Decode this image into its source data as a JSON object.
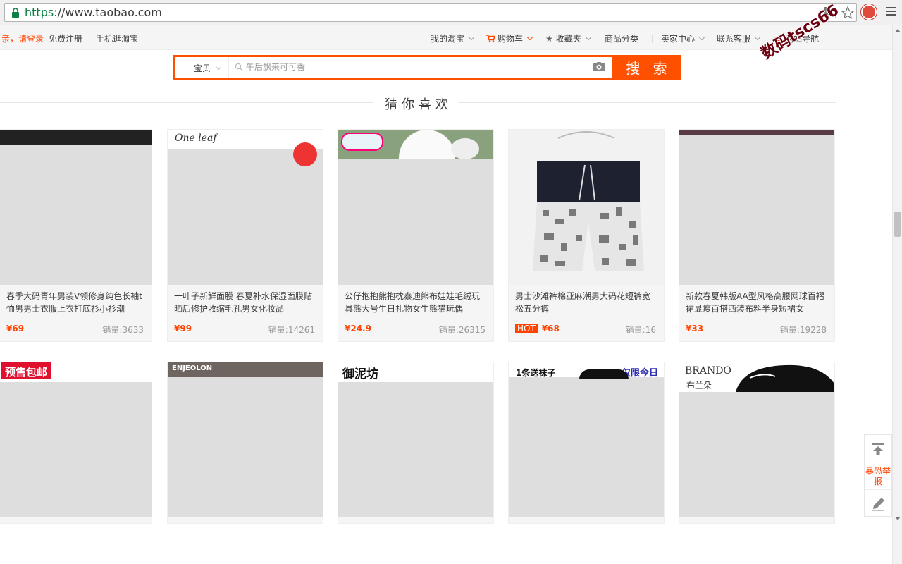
{
  "browser": {
    "url_scheme": "https",
    "url_rest": "://www.taobao.com"
  },
  "sitenav": {
    "login": "亲，请登录",
    "register": "免费注册",
    "mobile": "手机逛淘宝",
    "my_taobao": "我的淘宝",
    "cart": "购物车",
    "favorites": "收藏夹",
    "categories": "商品分类",
    "seller_center": "卖家中心",
    "contact": "联系客服",
    "site_nav": "网站导航"
  },
  "search": {
    "tab": "宝贝",
    "placeholder": "午后飘来可可香",
    "button": "搜 索"
  },
  "watermark": "数码tscs66",
  "section_title": "猜你喜欢",
  "products_row1": [
    {
      "title": "春季大码青年男装V领修身纯色长袖t恤男男士衣服上衣打底衫小衫潮",
      "price": "¥69",
      "sales": "销量:3633",
      "hot": ""
    },
    {
      "title": "一叶子新鲜面膜 春夏补水保湿面膜贴晒后修护收缩毛孔男女化妆品",
      "price": "¥99",
      "sales": "销量:14261",
      "hot": ""
    },
    {
      "title": "公仔抱抱熊抱枕泰迪熊布娃娃毛绒玩具熊大号生日礼物女生熊猫玩偶",
      "price": "¥24.9",
      "sales": "销量:26315",
      "hot": ""
    },
    {
      "title": "男士沙滩裤棉亚麻潮男大码花短裤宽松五分裤",
      "price": "¥68",
      "sales": "销量:16",
      "hot": "HOT"
    },
    {
      "title": "新款春夏韩版AA型风格高腰网球百褶裙显瘦百搭西装布料半身短裙女",
      "price": "¥33",
      "sales": "销量:19228",
      "hot": ""
    }
  ],
  "row2_labels": {
    "presale": "预售包邮",
    "enjeolon": "ENJEOLON",
    "yunifang": "御泥坊",
    "socks": "1条送袜子",
    "today_only": "仅限今日",
    "brando": "BRANDO",
    "brando_cn": "布兰朵"
  },
  "sidetool": {
    "report": "暴恐举报"
  },
  "colors": {
    "accent": "#ff5000",
    "price": "#ff4400"
  }
}
